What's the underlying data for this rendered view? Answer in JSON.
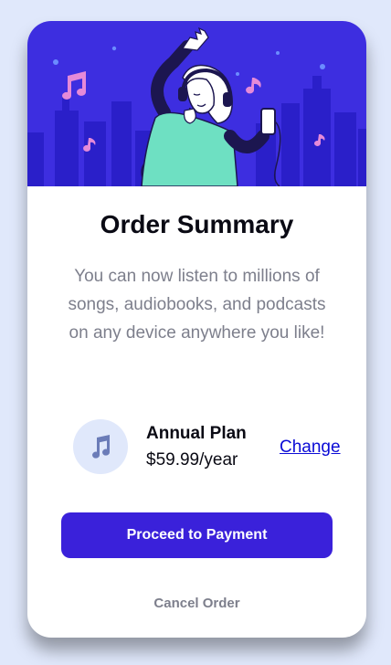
{
  "colors": {
    "page_background": "#e0e8fb",
    "card_background": "#ffffff",
    "hero_background": "#3d2ee0",
    "primary_button": "#3a21da",
    "title_text": "#0a0a14",
    "body_text": "#7d7f8c",
    "link": "#0b0bd6"
  },
  "hero": {
    "illustration": "person-listening-to-music-illustration",
    "icons": [
      "music-note-icon",
      "headphones-icon",
      "phone-icon"
    ]
  },
  "summary": {
    "title": "Order Summary",
    "description": "You can now listen to millions of songs, audiobooks, and podcasts on any device anywhere you like!"
  },
  "plan": {
    "icon": "music-note-icon",
    "name": "Annual Plan",
    "price": "$59.99/year",
    "change_label": "Change"
  },
  "actions": {
    "proceed_label": "Proceed to Payment",
    "cancel_label": "Cancel Order"
  }
}
